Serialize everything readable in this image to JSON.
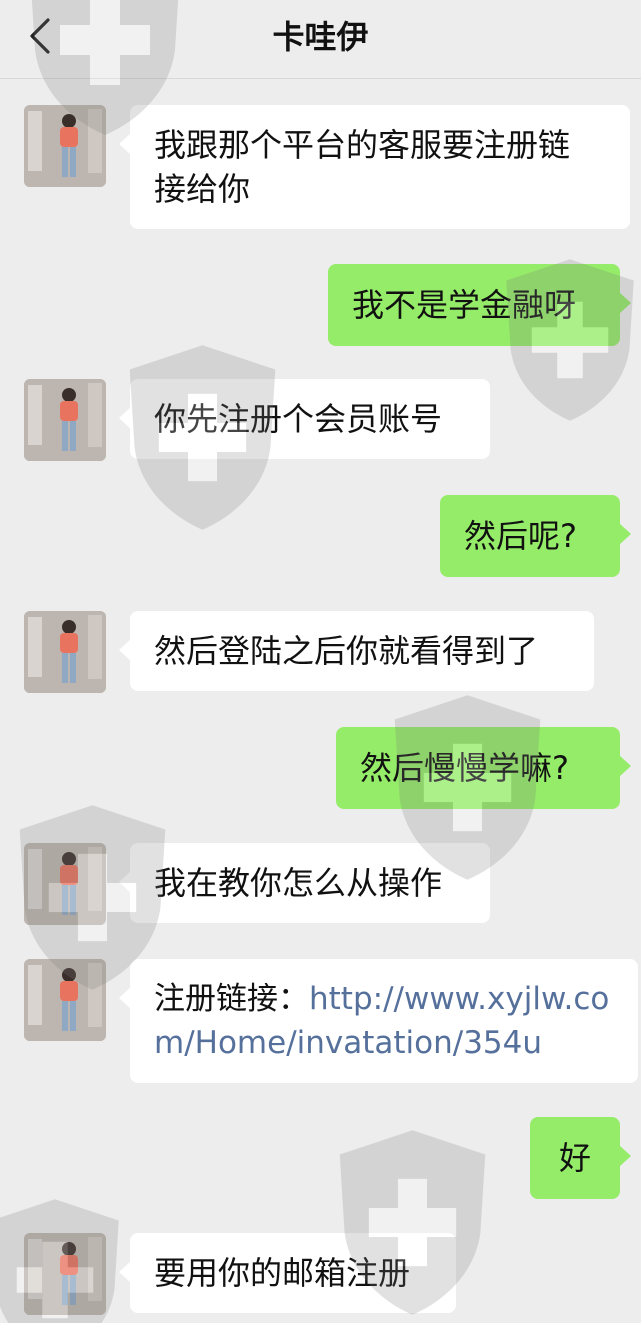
{
  "header": {
    "title": "卡哇伊",
    "back_icon": "chevron-left-icon"
  },
  "messages": [
    {
      "side": "left",
      "lines": [
        "我跟那个平台的客服要注册链",
        "接给你"
      ]
    },
    {
      "side": "right",
      "text": "我不是学金融呀"
    },
    {
      "side": "left",
      "text": "你先注册个会员账号"
    },
    {
      "side": "right",
      "text": "然后呢?"
    },
    {
      "side": "left",
      "text": "然后登陆之后你就看得到了"
    },
    {
      "side": "right",
      "text": "然后慢慢学嘛?"
    },
    {
      "side": "left",
      "text": "我在教你怎么从操作"
    },
    {
      "side": "left",
      "prefix": "注册链接：",
      "link_line1": "http://www.xyjlw.co",
      "link_line2": "m/Home/invatation/354u"
    },
    {
      "side": "right",
      "text": "好"
    },
    {
      "side": "left",
      "text": "要用你的邮箱注册"
    }
  ],
  "colors": {
    "background": "#ededed",
    "sent_bubble": "#95ec69",
    "received_bubble": "#ffffff",
    "link": "#56709c"
  },
  "watermark_icon": "shield-plus-icon"
}
